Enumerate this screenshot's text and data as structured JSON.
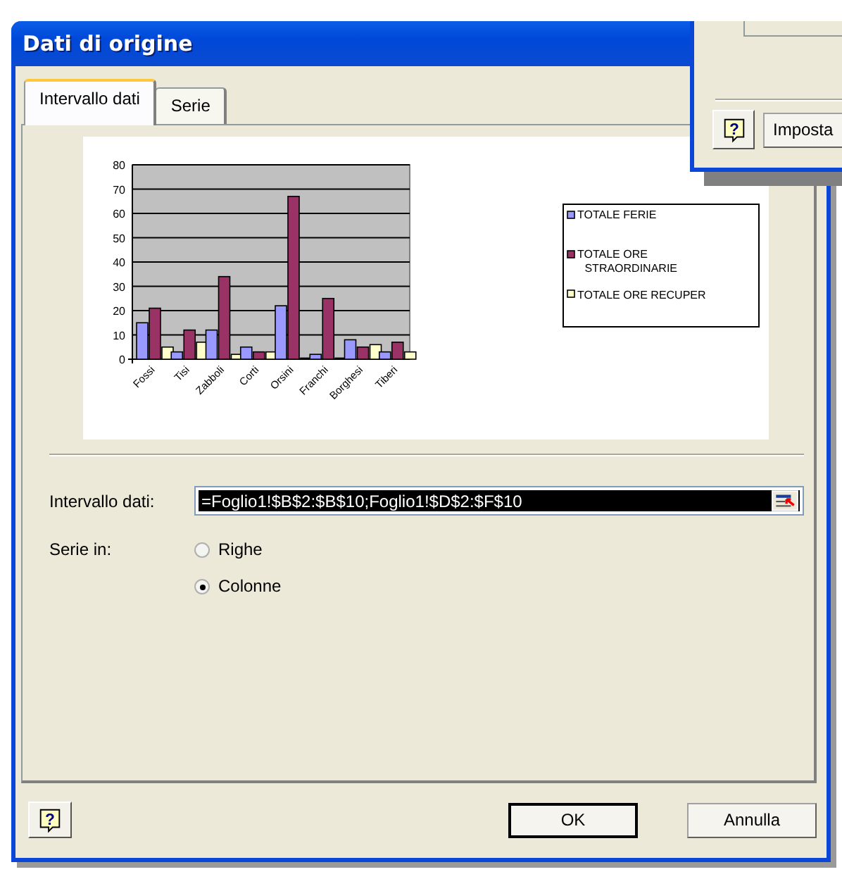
{
  "window": {
    "title": "Dati di origine"
  },
  "tabs": [
    {
      "label": "Intervallo dati",
      "selected": true
    },
    {
      "label": "Serie",
      "selected": false
    }
  ],
  "chart_data": {
    "type": "bar",
    "categories": [
      "Fossi",
      "Tisi",
      "Zabboli",
      "Corti",
      "Orsini",
      "Franchi",
      "Borghesi",
      "Tiberi"
    ],
    "ylim": [
      0,
      80
    ],
    "yticks": [
      0,
      10,
      20,
      30,
      40,
      50,
      60,
      70,
      80
    ],
    "series": [
      {
        "name": "TOTALE FERIE",
        "color": "#9999ff",
        "values": [
          15,
          3,
          12,
          5,
          22,
          2,
          8,
          3
        ]
      },
      {
        "name": "TOTALE ORE STRAORDINARIE",
        "color": "#993366",
        "values": [
          21,
          12,
          34,
          3,
          67,
          25,
          5,
          7
        ]
      },
      {
        "name": "TOTALE ORE RECUPER",
        "color": "#ffffcc",
        "values": [
          5,
          7,
          2,
          3,
          0,
          0,
          6,
          3
        ]
      }
    ],
    "grid": true,
    "legend": true
  },
  "range": {
    "label": "Intervallo dati:",
    "value": "=Foglio1!$B$2:$B$10;Foglio1!$D$2:$F$10"
  },
  "series_in": {
    "label": "Serie in:",
    "options": [
      {
        "label": "Righe",
        "selected": false
      },
      {
        "label": "Colonne",
        "selected": true
      }
    ]
  },
  "help_button": "?",
  "buttons": [
    {
      "label": "OK",
      "default": true
    },
    {
      "label": "Annulla",
      "default": false
    }
  ],
  "background_window": {
    "help_button": "?",
    "button": "Imposta"
  }
}
